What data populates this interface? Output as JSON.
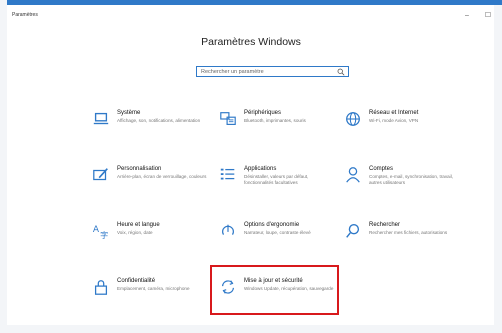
{
  "window": {
    "title": "Paramètres",
    "minimize_glyph": "–",
    "maximize_glyph": "☐"
  },
  "page": {
    "title": "Paramètres Windows"
  },
  "search": {
    "placeholder": "Rechercher un paramètre",
    "icon": "search-icon"
  },
  "accent_color": "#2f79c8",
  "highlight_color": "#d8191c",
  "tiles": [
    {
      "id": "systeme",
      "title": "Système",
      "desc": "Affichage, son, notifications, alimentation",
      "icon": "laptop-icon"
    },
    {
      "id": "peripheriques",
      "title": "Périphériques",
      "desc": "Bluetooth, imprimantes, souris",
      "icon": "keyboard-printer-icon"
    },
    {
      "id": "reseau",
      "title": "Réseau et Internet",
      "desc": "Wi-Fi, mode Avion, VPN",
      "icon": "globe-icon"
    },
    {
      "id": "personnalisation",
      "title": "Personnalisation",
      "desc": "Arrière-plan, écran de verrouillage, couleurs",
      "icon": "paintbrush-icon"
    },
    {
      "id": "applications",
      "title": "Applications",
      "desc": "Désinstaller, valeurs par défaut, fonctionnalités facultatives",
      "icon": "apps-list-icon"
    },
    {
      "id": "comptes",
      "title": "Comptes",
      "desc": "Comptes, e-mail, synchronisation, travail, autres utilisateurs",
      "icon": "person-icon"
    },
    {
      "id": "heure",
      "title": "Heure et langue",
      "desc": "Voix, région, date",
      "icon": "language-icon"
    },
    {
      "id": "ergonomie",
      "title": "Options d'ergonomie",
      "desc": "Narrateur, loupe, contraste élevé",
      "icon": "ease-of-access-icon"
    },
    {
      "id": "rechercher",
      "title": "Rechercher",
      "desc": "Rechercher mes fichiers, autorisations",
      "icon": "magnifier-icon"
    },
    {
      "id": "confidentialite",
      "title": "Confidentialité",
      "desc": "Emplacement, caméra, microphone",
      "icon": "lock-icon"
    },
    {
      "id": "maj",
      "title": "Mise à jour et sécurité",
      "desc": "Windows Update, récupération, sauvegarde",
      "icon": "sync-arrows-icon"
    }
  ]
}
